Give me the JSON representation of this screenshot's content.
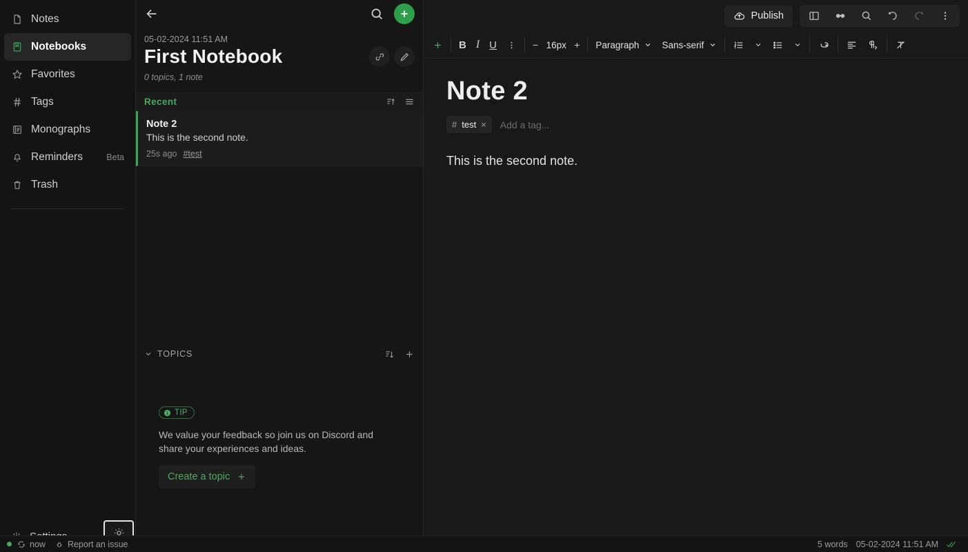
{
  "sidebar": {
    "items": [
      {
        "label": "Notes",
        "icon": "note-icon",
        "badge": ""
      },
      {
        "label": "Notebooks",
        "icon": "notebook-icon",
        "badge": ""
      },
      {
        "label": "Favorites",
        "icon": "star-icon",
        "badge": ""
      },
      {
        "label": "Tags",
        "icon": "hash-icon",
        "badge": ""
      },
      {
        "label": "Monographs",
        "icon": "monograph-icon",
        "badge": ""
      },
      {
        "label": "Reminders",
        "icon": "bell-icon",
        "badge": "Beta"
      },
      {
        "label": "Trash",
        "icon": "trash-icon",
        "badge": ""
      }
    ],
    "settings_label": "Settings",
    "theme_toggle_icon": "sun-icon"
  },
  "list_pane": {
    "back_icon": "back-arrow-icon",
    "search_icon": "search-icon",
    "add_icon": "plus-icon",
    "date": "05-02-2024 11:51 AM",
    "title": "First Notebook",
    "link_icon": "link-icon",
    "edit_icon": "pencil-icon",
    "meta": "0 topics, 1 note",
    "recent_label": "Recent",
    "sort_icon": "sort-ascending-icon",
    "view_icon": "list-view-icon",
    "notes": [
      {
        "title": "Note 2",
        "preview": "This is the second note.",
        "time": "25s ago",
        "tag": "#test"
      }
    ],
    "topics_label": "TOPICS",
    "topics_chevron_icon": "chevron-down-icon",
    "topics_sort_icon": "sort-descending-icon",
    "topics_add_icon": "plus-icon",
    "tip_badge": "TIP",
    "tip_text": "We value your feedback so join us on Discord and share your experiences and ideas.",
    "create_topic_label": "Create a topic"
  },
  "editor": {
    "publish_label": "Publish",
    "publish_icon": "cloud-upload-icon",
    "toolbar_icons": [
      {
        "name": "split-view-icon",
        "dim": false
      },
      {
        "name": "reading-mode-icon",
        "dim": false
      },
      {
        "name": "search-icon",
        "dim": false
      },
      {
        "name": "undo-icon",
        "dim": false
      },
      {
        "name": "redo-icon",
        "dim": true
      },
      {
        "name": "more-vertical-icon",
        "dim": false
      }
    ],
    "format": {
      "insert_label": "+",
      "bold_label": "B",
      "italic_label": "I",
      "underline_label": "U",
      "more_icon": "more-vertical-icon",
      "decrease_label": "−",
      "font_size": "16px",
      "increase_label": "+",
      "block_type": "Paragraph",
      "font_family": "Sans-serif",
      "ordered_list_icon": "ordered-list-icon",
      "bullet_list_icon": "bullet-list-icon",
      "link_icon": "insert-link-icon",
      "align_icon": "align-left-icon",
      "direction_icon": "text-direction-icon",
      "clear_format_icon": "clear-formatting-icon"
    },
    "note_title": "Note 2",
    "tags": [
      {
        "hash": "#",
        "label": "test",
        "remove": "×"
      }
    ],
    "tag_placeholder": "Add a tag...",
    "content": "This is the second note."
  },
  "status_bar": {
    "sync_label": "now",
    "sync_icon": "sync-icon",
    "report_label": "Report an issue",
    "report_icon": "bug-icon",
    "word_count": "5 words",
    "saved_date": "05-02-2024 11:51 AM",
    "saved_icon": "double-check-icon"
  },
  "colors": {
    "accent_green": "#2e9e4a",
    "text_green": "#4fa862",
    "background": "#151515",
    "panel": "#161616"
  }
}
